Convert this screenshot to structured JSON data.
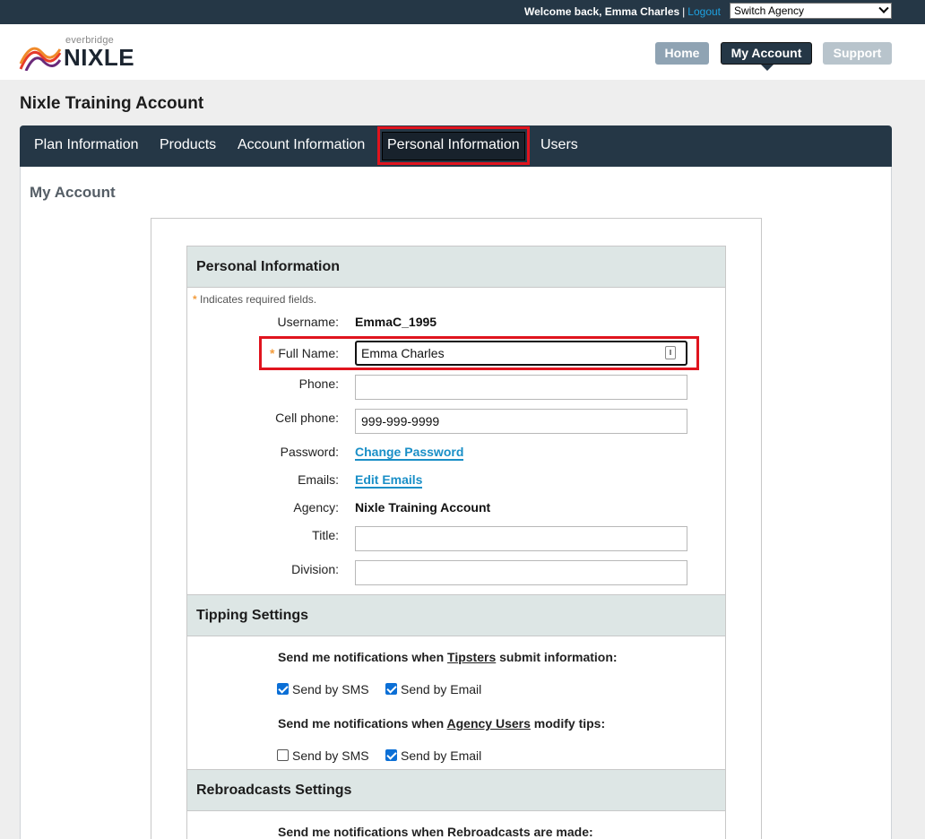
{
  "topbar": {
    "welcome": "Welcome back, Emma Charles",
    "separator": "|",
    "logout": "Logout",
    "agency_select": "Switch Agency"
  },
  "logo": {
    "small": "everbridge",
    "big": "NIXLE"
  },
  "nav": {
    "home": "Home",
    "my_account": "My Account",
    "support": "Support"
  },
  "org_title": "Nixle Training Account",
  "tabs": [
    {
      "label": "Plan Information"
    },
    {
      "label": "Products"
    },
    {
      "label": "Account Information"
    },
    {
      "label": "Personal Information",
      "active": true
    },
    {
      "label": "Users"
    }
  ],
  "page_heading": "My Account",
  "personal": {
    "heading": "Personal Information",
    "required_note": "Indicates required fields.",
    "required_star": "*",
    "username_label": "Username:",
    "username_value": "EmmaC_1995",
    "fullname_label": "Full Name:",
    "fullname_value": "Emma Charles",
    "phone_label": "Phone:",
    "phone_value": "",
    "cell_label": "Cell phone:",
    "cell_value": "999-999-9999",
    "password_label": "Password:",
    "password_link": "Change Password",
    "emails_label": "Emails:",
    "emails_link": "Edit Emails",
    "agency_label": "Agency:",
    "agency_value": "Nixle Training Account",
    "title_label": "Title:",
    "title_value": "",
    "division_label": "Division:",
    "division_value": ""
  },
  "tipping": {
    "heading": "Tipping Settings",
    "q1_pre": "Send me notifications when ",
    "q1_link": "Tipsters",
    "q1_post": " submit information:",
    "q1_sms": "Send by SMS",
    "q1_sms_checked": true,
    "q1_email": "Send by Email",
    "q1_email_checked": true,
    "q2_pre": "Send me notifications when ",
    "q2_link": "Agency Users",
    "q2_post": " modify tips:",
    "q2_sms": "Send by SMS",
    "q2_sms_checked": false,
    "q2_email": "Send by Email",
    "q2_email_checked": true
  },
  "rebroadcasts": {
    "heading": "Rebroadcasts Settings",
    "q1": "Send me notifications when Rebroadcasts are made:"
  },
  "colors": {
    "navy": "#253746",
    "highlight_red": "#e0141e",
    "link_blue": "#1a8fc7",
    "accent_orange": "#f39c3c"
  }
}
